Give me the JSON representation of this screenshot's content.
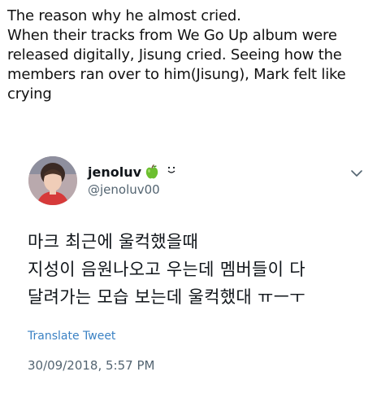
{
  "post": {
    "lines": [
      "The reason why he almost cried.",
      "When their tracks from We Go Up album were",
      "released digitally, Jisung cried. Seeing how the",
      "members ran over to him(Jisung), Mark felt like",
      "crying"
    ]
  },
  "quoted_tweet": {
    "display_name": "jenoluv",
    "handle": "@jenoluv00",
    "icons": [
      "avatar-photo",
      "green-apple-emoji",
      "smile-emoticon",
      "chevron-down-icon"
    ],
    "body_lines": [
      "마크 최근에 울컥했을때",
      "지성이 음원나오고 우는데 멤버들이 다",
      "달려가는 모습 보는데 울컥했대 ㅠㅡㅜ"
    ],
    "translate_label": "Translate Tweet",
    "timestamp": "30/09/2018, 5:57 PM",
    "colors": {
      "name": "#0f1419",
      "secondary": "#536471",
      "link": "#3b82c4"
    }
  }
}
